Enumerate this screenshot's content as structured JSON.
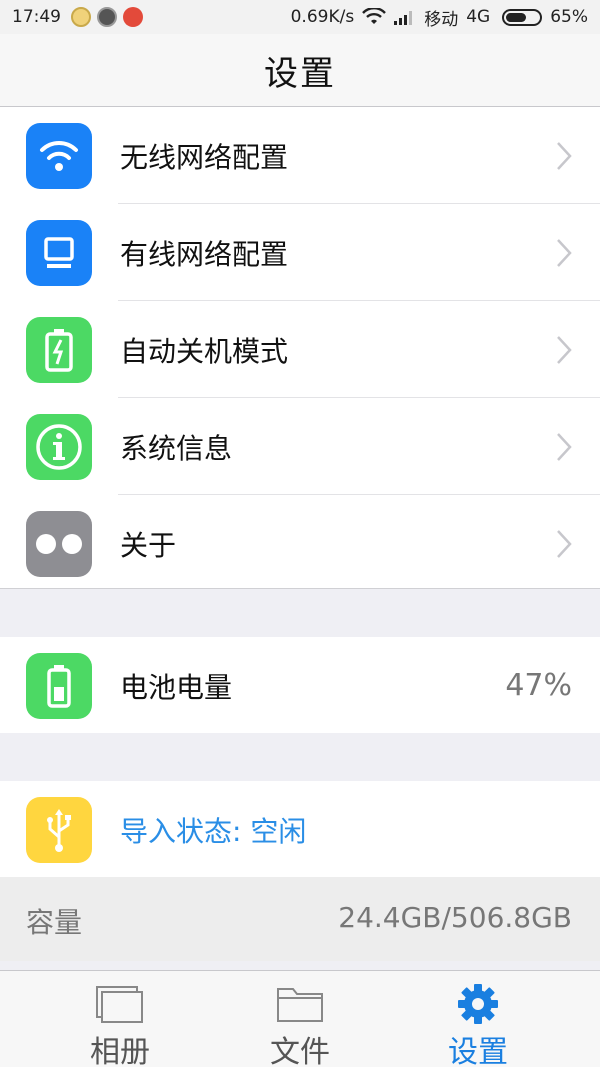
{
  "status_bar": {
    "time": "17:49",
    "net_speed": "0.69K/s",
    "carrier": "移动",
    "network": "4G",
    "battery_text": "65%",
    "battery_level": 0.65
  },
  "nav": {
    "title": "设置"
  },
  "settings_group": {
    "items": [
      {
        "label": "无线网络配置",
        "icon": "wifi-icon",
        "color": "#1a82f7"
      },
      {
        "label": "有线网络配置",
        "icon": "monitor-icon",
        "color": "#1a82f7"
      },
      {
        "label": "自动关机模式",
        "icon": "battery-charging-icon",
        "color": "#4cd964"
      },
      {
        "label": "系统信息",
        "icon": "info-icon",
        "color": "#4cd964"
      },
      {
        "label": "关于",
        "icon": "dots-icon",
        "color": "#8e8e93"
      }
    ]
  },
  "battery_group": {
    "label": "电池电量",
    "value": "47%",
    "icon": "battery-icon",
    "color": "#4cd964"
  },
  "import_group": {
    "label": "导入状态: 空闲",
    "icon": "usb-icon",
    "color": "#ffd63f",
    "link_color": "#2a8ee6"
  },
  "capacity": {
    "label": "容量",
    "value": "24.4GB/506.8GB"
  },
  "tabs": [
    {
      "label": "相册",
      "icon": "album-icon",
      "active": false
    },
    {
      "label": "文件",
      "icon": "folder-icon",
      "active": false
    },
    {
      "label": "设置",
      "icon": "gear-icon",
      "active": true
    }
  ],
  "colors": {
    "accent": "#1a7fe0",
    "background": "#efeff4"
  }
}
